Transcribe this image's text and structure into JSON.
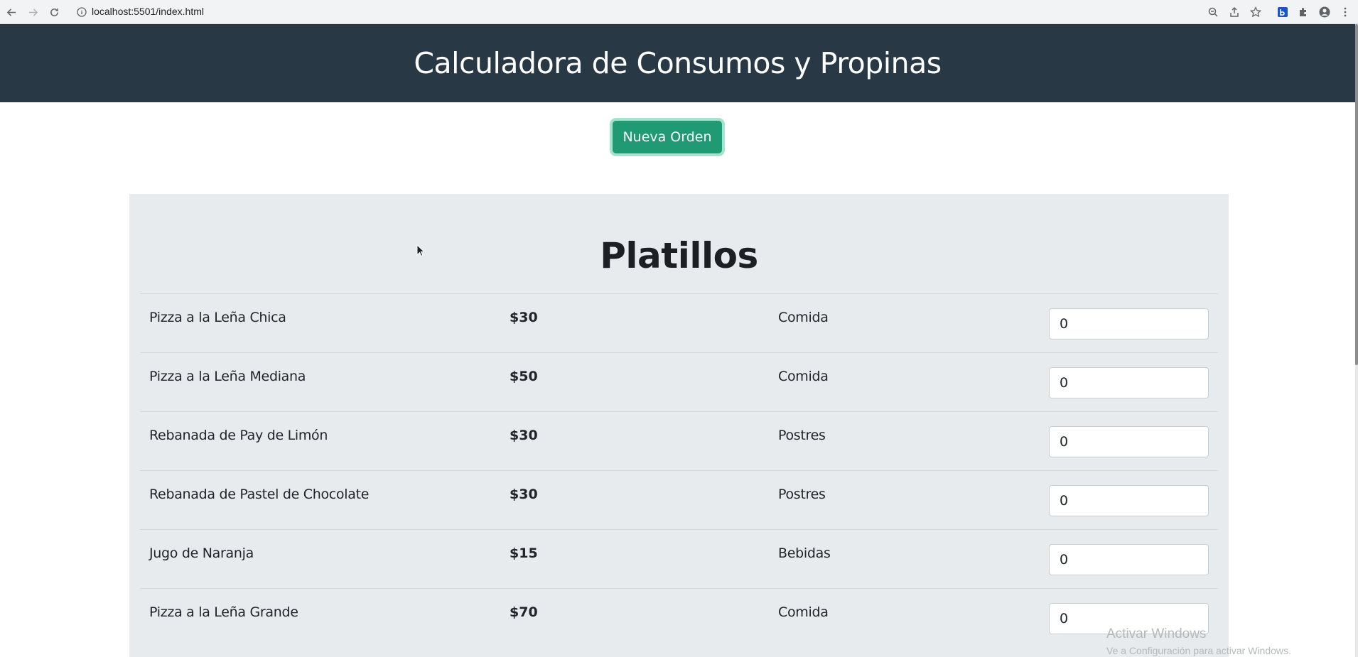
{
  "browser": {
    "url": "localhost:5501/index.html"
  },
  "header": {
    "title": "Calculadora de Consumos y Propinas"
  },
  "actions": {
    "new_order_label": "Nueva Orden"
  },
  "menu": {
    "title": "Platillos",
    "items": [
      {
        "name": "Pizza a la Leña Chica",
        "price": "$30",
        "category": "Comida",
        "quantity": "0"
      },
      {
        "name": "Pizza a la Leña Mediana",
        "price": "$50",
        "category": "Comida",
        "quantity": "0"
      },
      {
        "name": "Rebanada de Pay de Limón",
        "price": "$30",
        "category": "Postres",
        "quantity": "0"
      },
      {
        "name": "Rebanada de Pastel de Chocolate",
        "price": "$30",
        "category": "Postres",
        "quantity": "0"
      },
      {
        "name": "Jugo de Naranja",
        "price": "$15",
        "category": "Bebidas",
        "quantity": "0"
      },
      {
        "name": "Pizza a la Leña Grande",
        "price": "$70",
        "category": "Comida",
        "quantity": "0"
      }
    ]
  },
  "watermark": {
    "title": "Activar Windows",
    "subtitle": "Ve a Configuración para activar Windows."
  },
  "colors": {
    "header_bg": "#283845",
    "button_bg": "#1f9a72",
    "card_bg": "#e8ebed"
  }
}
